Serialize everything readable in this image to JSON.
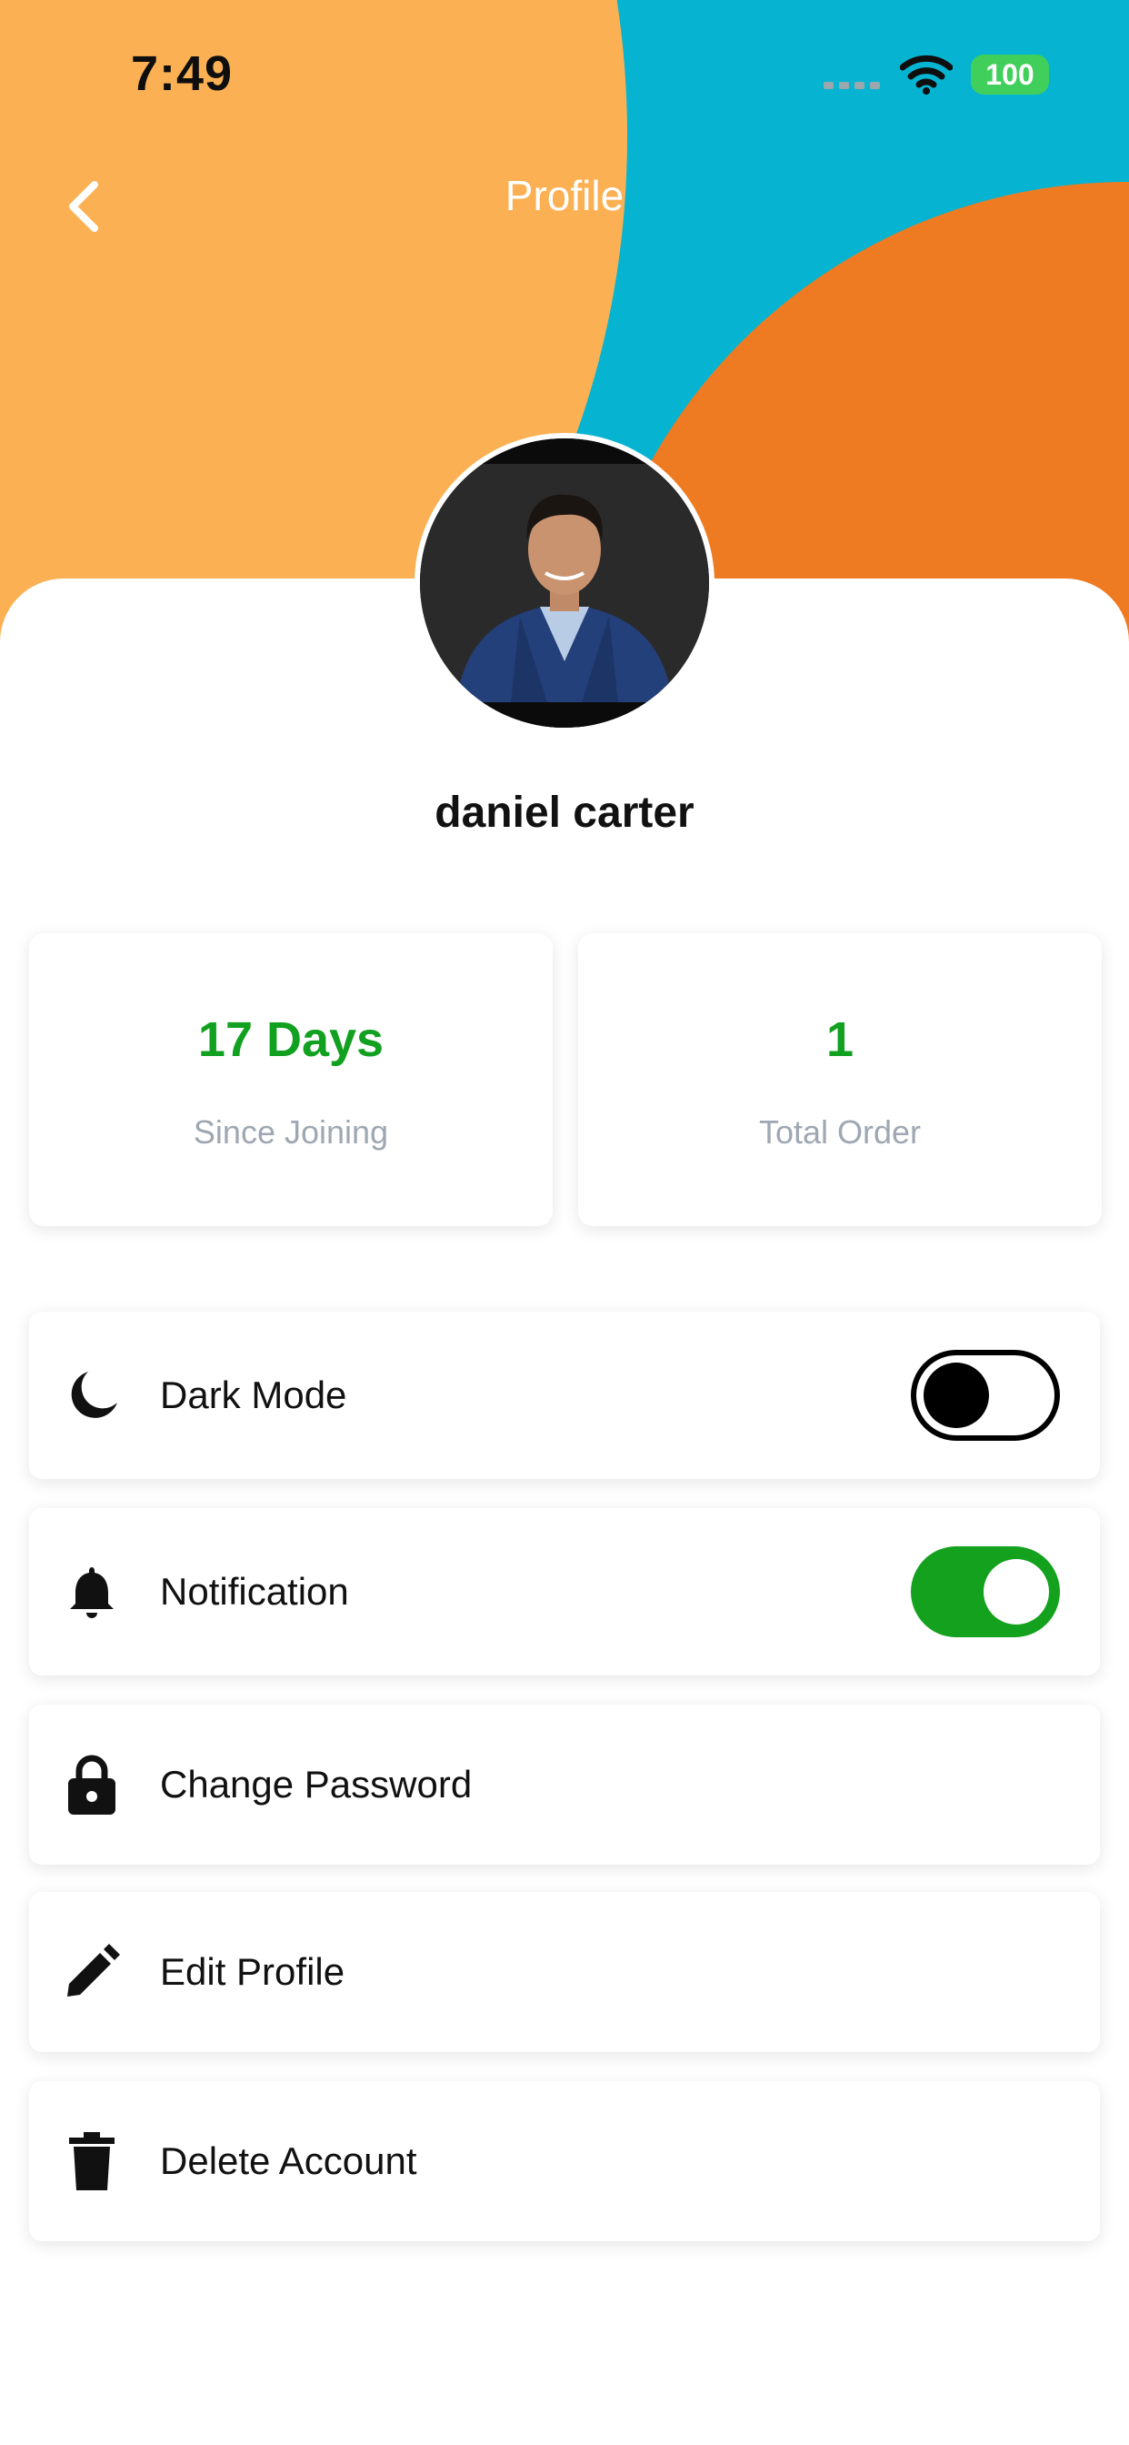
{
  "status_bar": {
    "time": "7:49",
    "battery": "100"
  },
  "header": {
    "title": "Profile"
  },
  "profile": {
    "name": "daniel carter"
  },
  "stats": [
    {
      "value": "17 Days",
      "label": "Since Joining"
    },
    {
      "value": "1",
      "label": "Total Order"
    }
  ],
  "menu": {
    "dark_mode": {
      "label": "Dark Mode",
      "enabled": false
    },
    "notification": {
      "label": "Notification",
      "enabled": true
    },
    "change_password": {
      "label": "Change Password"
    },
    "edit_profile": {
      "label": "Edit Profile"
    },
    "delete_account": {
      "label": "Delete Account"
    }
  },
  "colors": {
    "accent_green": "#14a11e",
    "header_orange_light": "#fbb153",
    "header_orange_dark": "#ee7b22",
    "header_cyan": "#06b4d2"
  },
  "icons": [
    "chevron-left-icon",
    "wifi-icon",
    "moon-icon",
    "bell-icon",
    "lock-icon",
    "pencil-icon",
    "trash-icon"
  ]
}
